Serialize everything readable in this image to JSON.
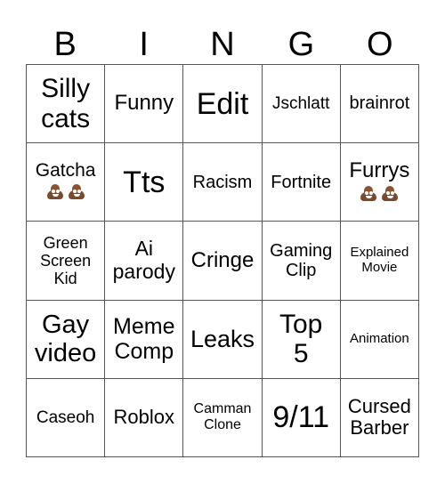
{
  "header": [
    "B",
    "I",
    "N",
    "G",
    "O"
  ],
  "cells": [
    {
      "text": "Silly\ncats",
      "size": 30,
      "emoji": 0
    },
    {
      "text": "Funny",
      "size": 24,
      "emoji": 0
    },
    {
      "text": "Edit",
      "size": 34,
      "emoji": 0
    },
    {
      "text": "Jschlatt",
      "size": 19,
      "emoji": 0
    },
    {
      "text": "brainrot",
      "size": 20,
      "emoji": 0
    },
    {
      "text": "Gatcha",
      "size": 21,
      "emoji": 2
    },
    {
      "text": "Tts",
      "size": 34,
      "emoji": 0
    },
    {
      "text": "Racism",
      "size": 20,
      "emoji": 0
    },
    {
      "text": "Fortnite",
      "size": 20,
      "emoji": 0
    },
    {
      "text": "Furrys",
      "size": 24,
      "emoji": 2
    },
    {
      "text": "Green\nScreen\nKid",
      "size": 18,
      "emoji": 0
    },
    {
      "text": "Ai\nparody",
      "size": 23,
      "emoji": 0
    },
    {
      "text": "Cringe",
      "size": 24,
      "emoji": 0
    },
    {
      "text": "Gaming\nClip",
      "size": 20,
      "emoji": 0
    },
    {
      "text": "Explained\nMovie",
      "size": 15,
      "emoji": 0
    },
    {
      "text": "Gay\nvideo",
      "size": 29,
      "emoji": 0
    },
    {
      "text": "Meme\nComp",
      "size": 25,
      "emoji": 0
    },
    {
      "text": "Leaks",
      "size": 27,
      "emoji": 0
    },
    {
      "text": "Top\n5",
      "size": 30,
      "emoji": 0
    },
    {
      "text": "Animation",
      "size": 15,
      "emoji": 0
    },
    {
      "text": "Caseoh",
      "size": 19,
      "emoji": 0
    },
    {
      "text": "Roblox",
      "size": 22,
      "emoji": 0
    },
    {
      "text": "Camman\nClone",
      "size": 16,
      "emoji": 0
    },
    {
      "text": "9/11",
      "size": 34,
      "emoji": 0
    },
    {
      "text": "Cursed\nBarber",
      "size": 22,
      "emoji": 0
    }
  ],
  "emoji_icon": "pile-of-poo-icon"
}
